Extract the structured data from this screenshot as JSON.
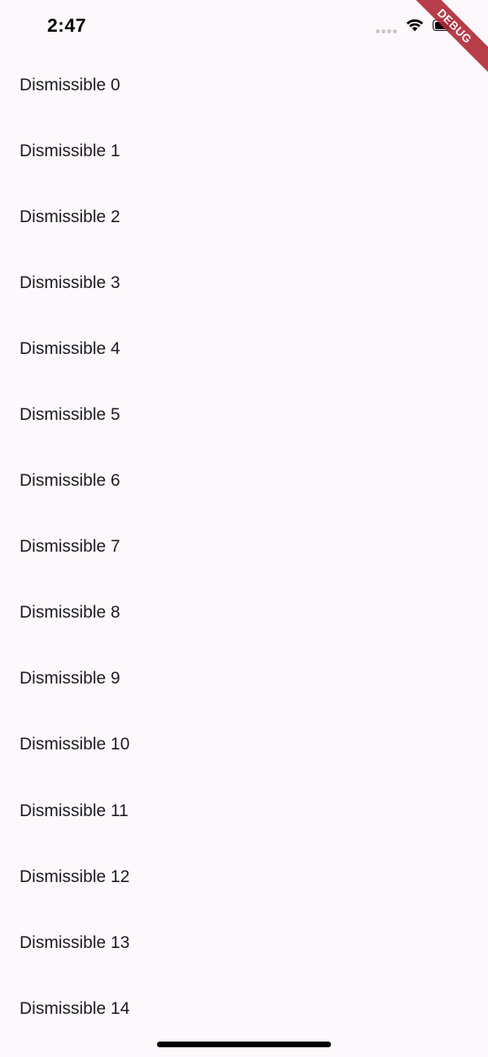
{
  "status_bar": {
    "time": "2:47"
  },
  "debug_banner": "DEBUG",
  "list": {
    "items": [
      "Dismissible 0",
      "Dismissible 1",
      "Dismissible 2",
      "Dismissible 3",
      "Dismissible 4",
      "Dismissible 5",
      "Dismissible 6",
      "Dismissible 7",
      "Dismissible 8",
      "Dismissible 9",
      "Dismissible 10",
      "Dismissible 11",
      "Dismissible 12",
      "Dismissible 13",
      "Dismissible 14"
    ]
  },
  "icons": {
    "cellular": "cellular-signal-icon",
    "wifi": "wifi-icon",
    "battery": "battery-icon"
  },
  "colors": {
    "background": "#fcf8fc",
    "text": "#1d1b20",
    "debug_ribbon": "#b02a36"
  }
}
